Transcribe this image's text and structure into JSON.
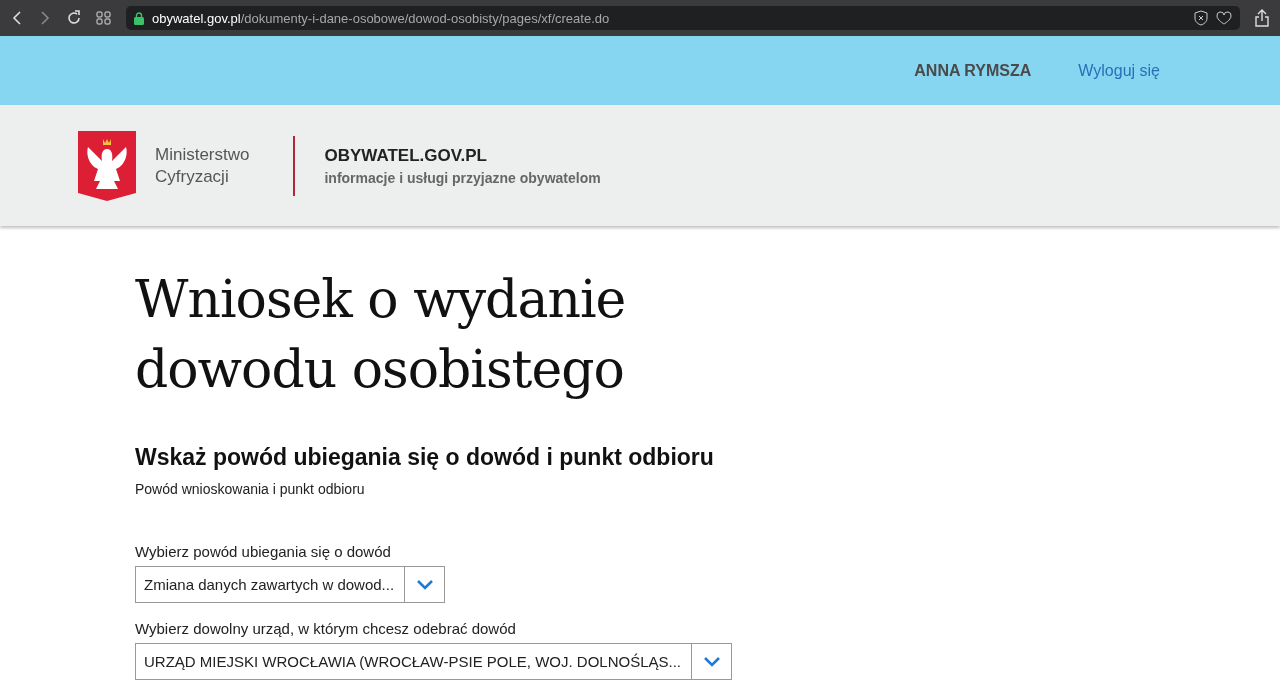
{
  "browser": {
    "address": "**obywatel.gov.pl**/dokumenty-i-dane-osobowe/dowod-osobisty/pages/xf/create.do",
    "secure": true
  },
  "top_bar": {
    "user_name": "ANNA RYMSZA",
    "logout": "Wyloguj się"
  },
  "header": {
    "ministry_line1": "Ministerstwo",
    "ministry_line2": "Cyfryzacji",
    "site_title": "OBYWATEL.GOV.PL",
    "site_tagline": "informacje i usługi przyjazne obywatelom"
  },
  "form": {
    "title_line1": "Wniosek o wydanie",
    "title_line2": "dowodu osobistego",
    "section_title": "Wskaż powód ubiegania się o dowód i punkt odbioru",
    "section_subtitle": "Powód wnioskowania i punkt odbioru",
    "fields": [
      {
        "label": "Wybierz powód ubiegania się o dowód",
        "value": "Zmiana danych zawartych w dowod..."
      },
      {
        "label": "Wybierz dowolny urząd, w którym chcesz odebrać dowód",
        "value": "URZĄD MIEJSKI WROCŁAWIA (WROCŁAW-PSIE POLE, WOJ. DOLNOŚLĄS..."
      }
    ]
  }
}
